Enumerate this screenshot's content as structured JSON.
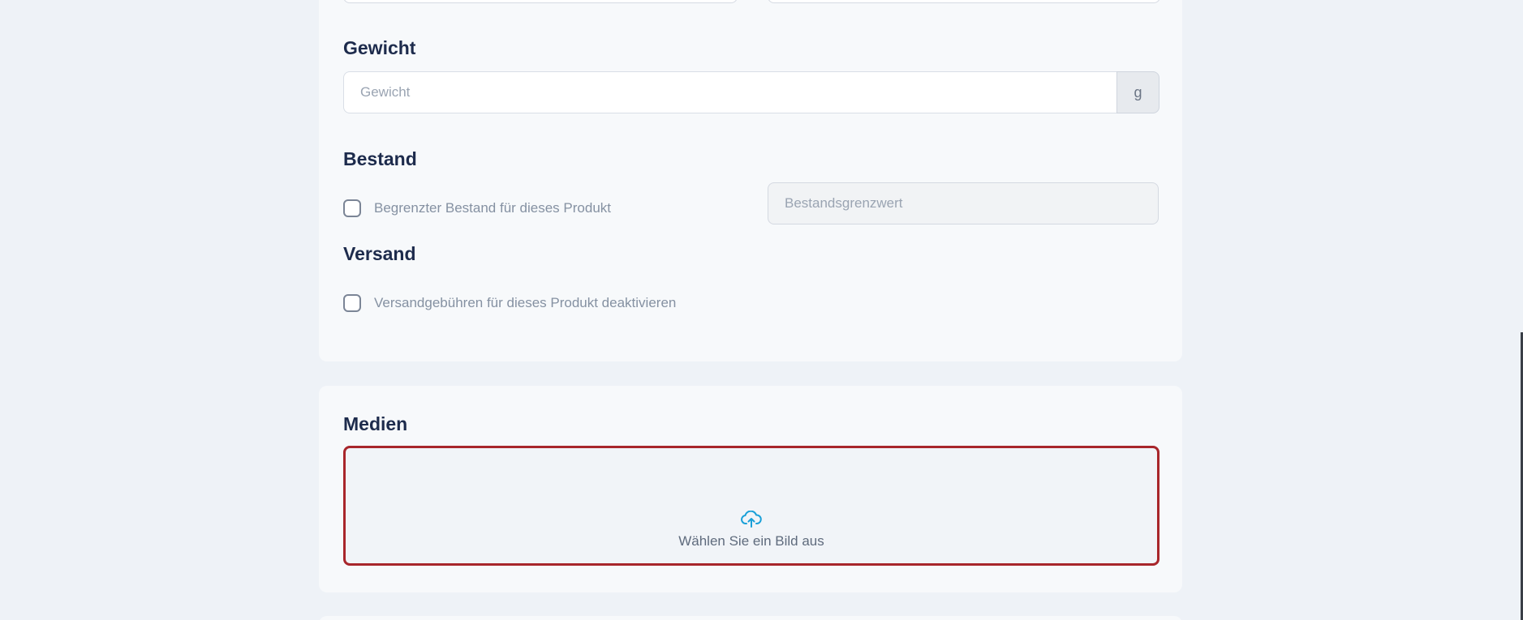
{
  "weight": {
    "heading": "Gewicht",
    "placeholder": "Gewicht",
    "unit": "g"
  },
  "stock": {
    "heading": "Bestand",
    "limited_label": "Begrenzter Bestand für dieses Produkt",
    "threshold_placeholder": "Bestandsgrenzwert"
  },
  "shipping": {
    "heading": "Versand",
    "disable_fees_label": "Versandgebühren für dieses Produkt deaktivieren"
  },
  "media": {
    "heading": "Medien",
    "upload_label": "Wählen Sie ein Bild aus",
    "upload_icon": "cloud-upload-icon"
  },
  "colors": {
    "heading": "#1d2b4c",
    "accent_icon": "#1aa0d8",
    "highlight_border": "#a8262b"
  }
}
